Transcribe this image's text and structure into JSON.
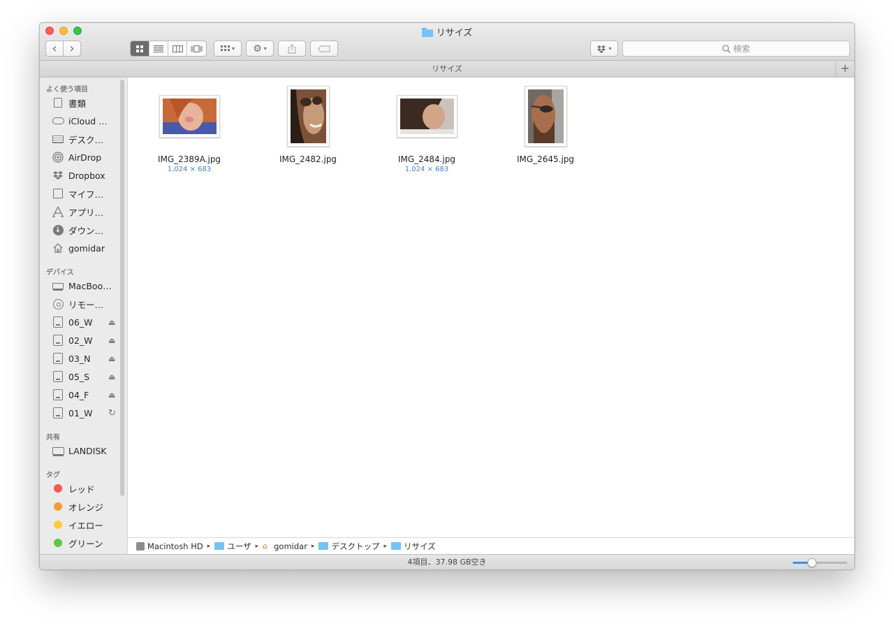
{
  "window": {
    "title": "リサイズ",
    "path_title": "リサイズ",
    "plus_label": "+"
  },
  "toolbar": {
    "back_glyph": "‹",
    "forward_glyph": "›",
    "search_placeholder": "検索",
    "view_modes": [
      "icon",
      "list",
      "column",
      "cover-flow"
    ],
    "active_view": "icon"
  },
  "sidebar": {
    "favorites_header": "よく使う項目",
    "favorites": [
      {
        "label": "書類",
        "icon": "document-icon"
      },
      {
        "label": "iCloud Drive",
        "icon": "cloud-icon"
      },
      {
        "label": "デスクトップ",
        "icon": "desktop-icon"
      },
      {
        "label": "AirDrop",
        "icon": "airdrop-icon"
      },
      {
        "label": "Dropbox",
        "icon": "dropbox-icon"
      },
      {
        "label": "マイファイル",
        "icon": "all-files-icon"
      },
      {
        "label": "アプリケーション",
        "icon": "applications-icon"
      },
      {
        "label": "ダウンロード",
        "icon": "download-icon"
      },
      {
        "label": "gomidar",
        "icon": "home-icon"
      }
    ],
    "devices_header": "デバイス",
    "devices": [
      {
        "label": "MacBook Pro",
        "icon": "laptop-icon",
        "extra": ""
      },
      {
        "label": "リモートディスク",
        "icon": "disc-icon",
        "extra": ""
      },
      {
        "label": "06_W",
        "icon": "drive-icon",
        "extra": "⏏"
      },
      {
        "label": "02_W",
        "icon": "drive-icon",
        "extra": "⏏"
      },
      {
        "label": "03_N",
        "icon": "drive-icon",
        "extra": "⏏"
      },
      {
        "label": "05_S",
        "icon": "drive-icon",
        "extra": "⏏"
      },
      {
        "label": "04_F",
        "icon": "drive-icon",
        "extra": "⏏"
      },
      {
        "label": "01_W",
        "icon": "drive-icon",
        "extra": "↻"
      }
    ],
    "shared_header": "共有",
    "shared": [
      {
        "label": "LANDISK",
        "icon": "monitor-icon"
      }
    ],
    "tags_header": "タグ",
    "tags": [
      {
        "label": "レッド",
        "color": "#f3594f"
      },
      {
        "label": "オレンジ",
        "color": "#f49b33"
      },
      {
        "label": "イエロー",
        "color": "#f8cc3a"
      },
      {
        "label": "グリーン",
        "color": "#5ec844"
      }
    ]
  },
  "files": [
    {
      "name": "IMG_2389A.jpg",
      "dims": "1,024 × 683",
      "orientation": "landscape",
      "colors": [
        "#c66a3a",
        "#e7b39a",
        "#4a5aa8"
      ]
    },
    {
      "name": "IMG_2482.jpg",
      "dims": "",
      "orientation": "portrait",
      "colors": [
        "#2a1d16",
        "#c79a7a",
        "#7a5238"
      ]
    },
    {
      "name": "IMG_2484.jpg",
      "dims": "1,024 × 683",
      "orientation": "landscape",
      "colors": [
        "#3b2a22",
        "#d2a488",
        "#c9c3bd"
      ]
    },
    {
      "name": "IMG_2645.jpg",
      "dims": "",
      "orientation": "portrait",
      "colors": [
        "#6f6a66",
        "#a76e4d",
        "#2f2b2a"
      ]
    }
  ],
  "breadcrumb": [
    {
      "label": "Macintosh HD",
      "icon": "hard-disk-icon"
    },
    {
      "label": "ユーザ",
      "icon": "folder-icon"
    },
    {
      "label": "gomidar",
      "icon": "home-icon"
    },
    {
      "label": "デスクトップ",
      "icon": "folder-icon"
    },
    {
      "label": "リサイズ",
      "icon": "folder-icon"
    }
  ],
  "status": {
    "text": "4項目、37.98 GB空き",
    "zoom_level": 0.35
  }
}
